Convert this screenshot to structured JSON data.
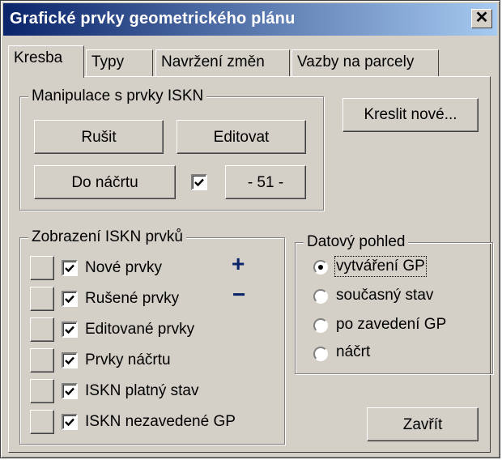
{
  "window": {
    "title": "Grafické prvky geometrického plánu",
    "close_label": "✕"
  },
  "tabs": [
    {
      "label": "Kresba"
    },
    {
      "label": "Typy"
    },
    {
      "label": "Navržení změn"
    },
    {
      "label": "Vazby na parcely"
    }
  ],
  "manipulace": {
    "legend": "Manipulace s prvky ISKN",
    "rusit": "Rušit",
    "editovat": "Editovat",
    "do_nacrtu": "Do náčrtu",
    "nacrt_checked": true,
    "nacrt_number": "- 51 -"
  },
  "kreslit_nove": "Kreslit nové...",
  "zobrazeni": {
    "legend": "Zobrazení ISKN prvků",
    "items": [
      {
        "label": "Nové prvky",
        "checked": true,
        "symbol": "+"
      },
      {
        "label": "Rušené prvky",
        "checked": true,
        "symbol": "−"
      },
      {
        "label": "Editované prvky",
        "checked": true,
        "symbol": ""
      },
      {
        "label": "Prvky náčrtu",
        "checked": true,
        "symbol": ""
      },
      {
        "label": "ISKN platný stav",
        "checked": true,
        "symbol": ""
      },
      {
        "label": "ISKN nezavedené GP",
        "checked": true,
        "symbol": ""
      }
    ]
  },
  "datovy_pohled": {
    "legend": "Datový pohled",
    "selected": "vytváření GP",
    "options": [
      {
        "label": "vytváření GP"
      },
      {
        "label": "současný stav"
      },
      {
        "label": "po zavedení GP"
      },
      {
        "label": "náčrt"
      }
    ]
  },
  "zavrit": "Zavřít"
}
